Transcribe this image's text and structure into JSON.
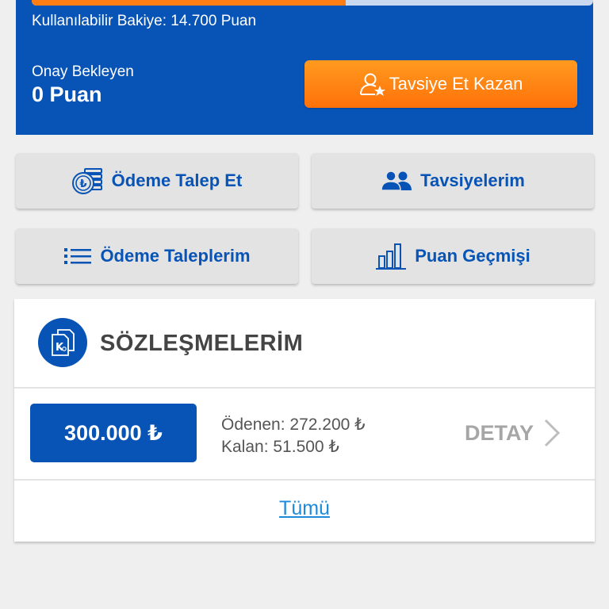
{
  "wallet": {
    "progress_fraction": 0.56,
    "balance_text": "Kullanılabilir Bakiye: 14.700 Puan",
    "pending_label": "Onay Bekleyen",
    "pending_value": "0 Puan",
    "refer_button_label": "Tavsiye Et Kazan"
  },
  "actions": [
    {
      "label": "Ödeme Talep Et",
      "icon": "coin-stack-icon"
    },
    {
      "label": "Tavsiyelerim",
      "icon": "people-icon"
    },
    {
      "label": "Ödeme Taleplerim",
      "icon": "list-icon"
    },
    {
      "label": "Puan Geçmişi",
      "icon": "bar-chart-icon"
    }
  ],
  "contracts": {
    "title": "SÖZLEŞMELERİM",
    "icon": "contract-document-icon",
    "item": {
      "amount": "300.000 ₺",
      "paid": "Ödenen: 272.200 ₺",
      "remaining": "Kalan: 51.500 ₺",
      "detail_label": "DETAY"
    },
    "all_link": "Tümü"
  },
  "colors": {
    "brand_blue": "#0753b6",
    "accent_orange": "#ff7e14",
    "link_blue": "#1d8bd9"
  }
}
